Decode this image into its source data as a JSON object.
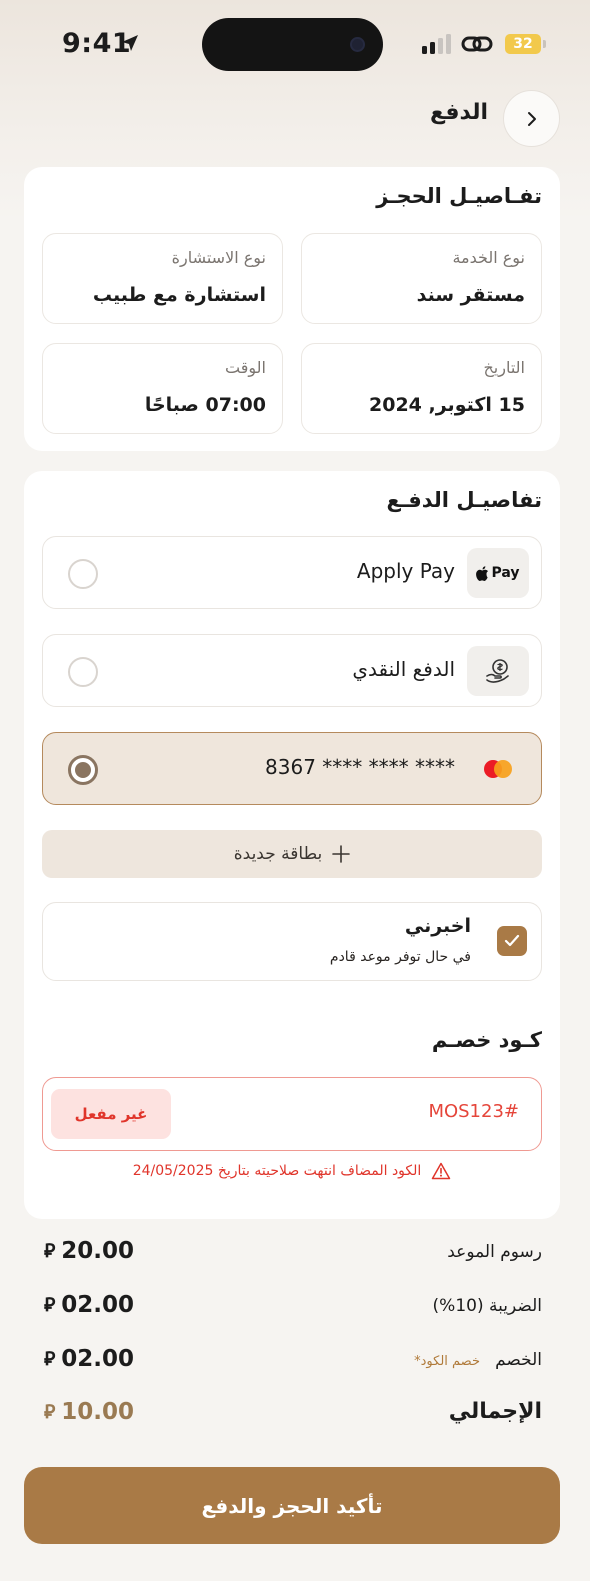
{
  "status_bar": {
    "time": "9:41",
    "battery": "32"
  },
  "header": {
    "title": "الدفع"
  },
  "booking": {
    "title": "تفـاصيـل الحجـز",
    "service_type_label": "نوع الخدمة",
    "service_type_value": "مستقر سند",
    "consultation_type_label": "نوع الاستشارة",
    "consultation_type_value": "استشارة مع طبيب",
    "date_label": "التاريخ",
    "date_value": "15 اكتوبر, 2024",
    "time_label": "الوقت",
    "time_value": "07:00 صباحًا"
  },
  "payment": {
    "title": "تفاصيـل الدفـع",
    "options": [
      {
        "label": "Apply Pay",
        "icon": "apple-pay-icon",
        "selected": false,
        "badge": "Pay"
      },
      {
        "label": "الدفع النقدي",
        "icon": "cash-icon",
        "selected": false
      },
      {
        "label": "8367 **** **** ****",
        "icon": "mastercard-icon",
        "selected": true
      }
    ],
    "new_card_label": "بطاقة جديدة"
  },
  "notify": {
    "title": "اخبرني",
    "subtitle": "في حال توفر موعد قادم",
    "checked": true
  },
  "promo": {
    "title": "كـود خصـم",
    "code": "MOS123#",
    "status": "غير مفعل",
    "error": "الكود المضاف انتهت صلاحيته بتاريخ 24/05/2025"
  },
  "summary": {
    "appointment_fee_label": "رسوم الموعد",
    "appointment_fee_value": "20.00",
    "tax_label": "الضريبة (10%)",
    "tax_value": "02.00",
    "discount_label": "الخصم",
    "discount_note": "خصم الكود*",
    "discount_value": "02.00",
    "total_label": "الإجمالي",
    "total_value": "10.00",
    "currency": "⃁"
  },
  "confirm_button": "تأكيد الحجز والدفع",
  "colors": {
    "accent": "#a97a46",
    "selected_bg": "#efe6dc",
    "error": "#e0352b",
    "background": "#f6f4f1"
  }
}
